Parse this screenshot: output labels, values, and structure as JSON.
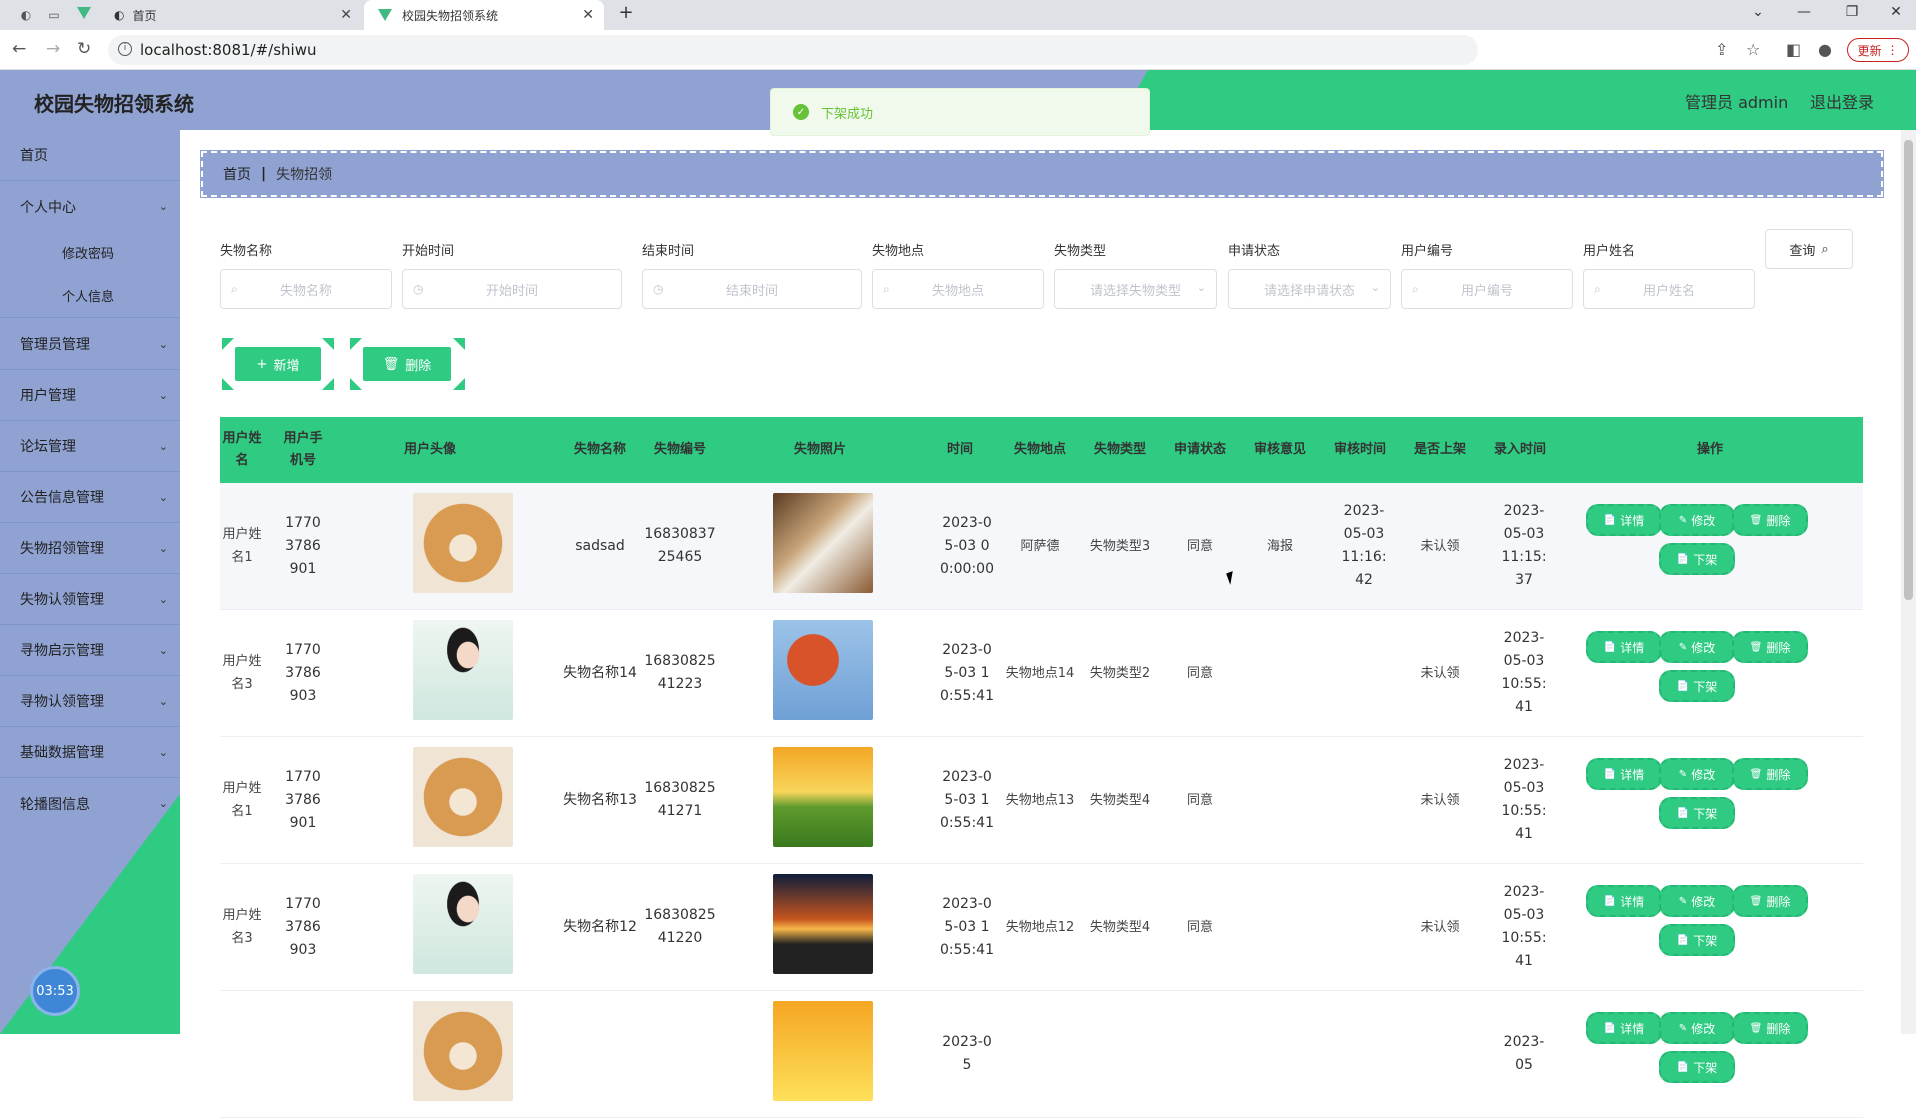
{
  "browser": {
    "tabs": [
      {
        "label": "首页",
        "active": false
      },
      {
        "label": "校园失物招领系统",
        "active": true
      }
    ],
    "url": "localhost:8081/#/shiwu",
    "update_label": "更新"
  },
  "header": {
    "title": "校园失物招领系统",
    "admin": "管理员 admin",
    "logout": "退出登录",
    "toast": "下架成功"
  },
  "sidebar": {
    "items": [
      {
        "label": "首页"
      },
      {
        "label": "个人中心"
      },
      {
        "label": "修改密码"
      },
      {
        "label": "个人信息"
      },
      {
        "label": "管理员管理"
      },
      {
        "label": "用户管理"
      },
      {
        "label": "论坛管理"
      },
      {
        "label": "公告信息管理"
      },
      {
        "label": "失物招领管理"
      },
      {
        "label": "失物认领管理"
      },
      {
        "label": "寻物启示管理"
      },
      {
        "label": "寻物认领管理"
      },
      {
        "label": "基础数据管理"
      },
      {
        "label": "轮播图信息"
      }
    ],
    "timer": "03:53"
  },
  "breadcrumb": {
    "home": "首页",
    "sep": "|",
    "current": "失物招领"
  },
  "search": {
    "fields": [
      {
        "label": "失物名称",
        "placeholder": "失物名称"
      },
      {
        "label": "开始时间",
        "placeholder": "开始时间"
      },
      {
        "label": "结束时间",
        "placeholder": "结束时间"
      },
      {
        "label": "失物地点",
        "placeholder": "失物地点"
      },
      {
        "label": "失物类型",
        "placeholder": "请选择失物类型"
      },
      {
        "label": "申请状态",
        "placeholder": "请选择申请状态"
      },
      {
        "label": "用户编号",
        "placeholder": "用户编号"
      },
      {
        "label": "用户姓名",
        "placeholder": "用户姓名"
      }
    ],
    "query": "查询"
  },
  "actions": {
    "add": "新增",
    "delete": "删除"
  },
  "table": {
    "columns": [
      "用户姓名",
      "用户手机号",
      "用户头像",
      "失物名称",
      "失物编号",
      "失物照片",
      "时间",
      "失物地点",
      "失物类型",
      "申请状态",
      "审核意见",
      "审核时间",
      "是否上架",
      "录入时间",
      "操作"
    ],
    "op_labels": {
      "detail": "详情",
      "edit": "修改",
      "delete": "删除",
      "offshelf": "下架"
    },
    "rows": [
      {
        "user_name": "用户姓名1",
        "phone": "17703786901",
        "avatar": "shiba-dog",
        "item_name": "sadsad",
        "item_no": "1683083725465",
        "photo": "waterfall",
        "time": "2023-05-03 00:00:00",
        "place": "阿萨德",
        "type": "失物类型3",
        "apply_status": "同意",
        "review_opinion": "海报",
        "review_time": "2023-05-03 11:16:42",
        "shelved": "未认领",
        "entry_time": "2023-05-03 11:15:37"
      },
      {
        "user_name": "用户姓名3",
        "phone": "17703786903",
        "avatar": "woman-portrait",
        "item_name": "失物名称14",
        "item_no": "1683082541223",
        "photo": "autumn-leaves",
        "time": "2023-05-03 10:55:41",
        "place": "失物地点14",
        "type": "失物类型2",
        "apply_status": "同意",
        "review_opinion": "",
        "review_time": "",
        "shelved": "未认领",
        "entry_time": "2023-05-03 10:55:41"
      },
      {
        "user_name": "用户姓名1",
        "phone": "17703786901",
        "avatar": "shiba-dog",
        "item_name": "失物名称13",
        "item_no": "1683082541271",
        "photo": "sunny-meadow",
        "time": "2023-05-03 10:55:41",
        "place": "失物地点13",
        "type": "失物类型4",
        "apply_status": "同意",
        "review_opinion": "",
        "review_time": "",
        "shelved": "未认领",
        "entry_time": "2023-05-03 10:55:41"
      },
      {
        "user_name": "用户姓名3",
        "phone": "17703786903",
        "avatar": "woman-portrait",
        "item_name": "失物名称12",
        "item_no": "1683082541220",
        "photo": "sunset-road",
        "time": "2023-05-03 10:55:41",
        "place": "失物地点12",
        "type": "失物类型4",
        "apply_status": "同意",
        "review_opinion": "",
        "review_time": "",
        "shelved": "未认领",
        "entry_time": "2023-05-03 10:55:41"
      },
      {
        "user_name": "",
        "phone": "",
        "avatar": "shiba-dog",
        "item_name": "",
        "item_no": "",
        "photo": "golden-sky",
        "time": "2023-05",
        "place": "",
        "type": "",
        "apply_status": "",
        "review_opinion": "",
        "review_time": "",
        "shelved": "",
        "entry_time": "2023-05"
      }
    ]
  },
  "colors": {
    "green": "#2fcb83",
    "blue": "#8fa2d2"
  }
}
